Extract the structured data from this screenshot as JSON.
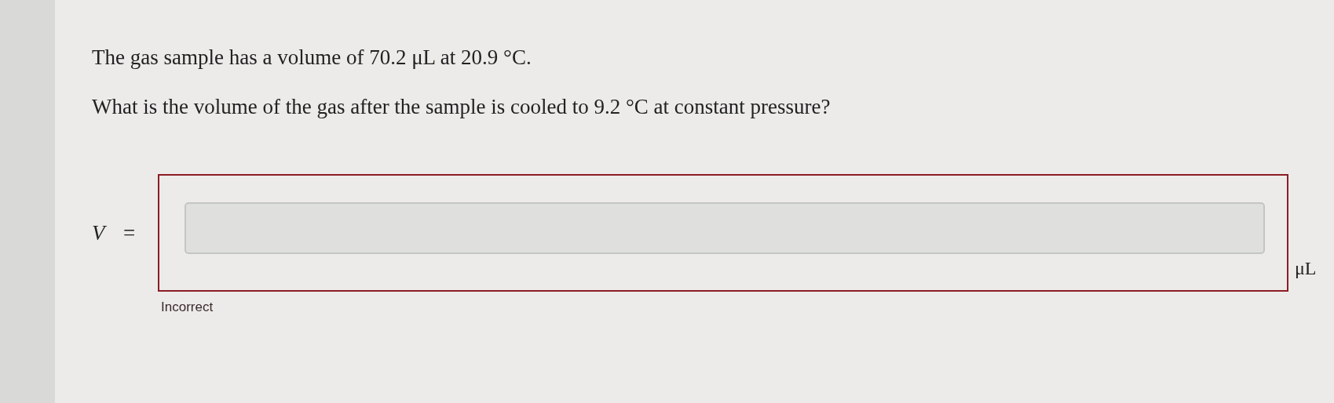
{
  "question": {
    "given": "The gas sample has a volume of 70.2 μL at 20.9 °C.",
    "prompt": "What is the volume of the gas after the sample is cooled to 9.2 °C at constant pressure?"
  },
  "answer": {
    "variable": "V",
    "equals": "=",
    "unit": "μL",
    "incorrect": true,
    "feedback": "Incorrect"
  }
}
